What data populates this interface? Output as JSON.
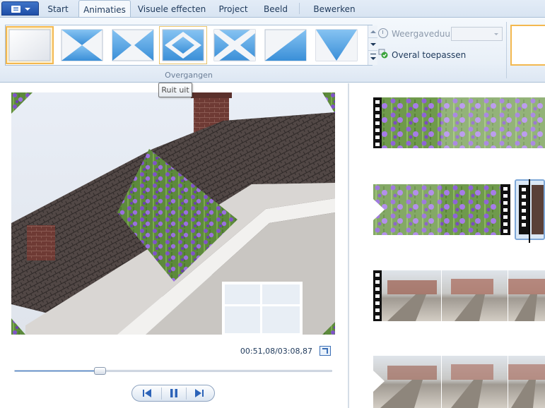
{
  "tabs": [
    {
      "label": "Start",
      "active": false
    },
    {
      "label": "Animaties",
      "active": true
    },
    {
      "label": "Visuele effecten",
      "active": false
    },
    {
      "label": "Project",
      "active": false
    },
    {
      "label": "Beeld",
      "active": false
    },
    {
      "label": "Bewerken",
      "active": false
    }
  ],
  "ribbon": {
    "group_label": "Overgangen",
    "transitions": [
      {
        "icon": "no-transition-icon",
        "selected": true
      },
      {
        "icon": "bowtie-vertical-icon",
        "selected": false
      },
      {
        "icon": "bowtie-horizontal-icon",
        "selected": false
      },
      {
        "icon": "diamond-out-icon",
        "selected": false,
        "hover": true
      },
      {
        "icon": "cross-icon",
        "selected": false
      },
      {
        "icon": "diagonal-wipe-icon",
        "selected": false
      },
      {
        "icon": "v-wipe-icon",
        "selected": false
      }
    ],
    "duration_label": "Weergaveduur:",
    "duration_value": "",
    "apply_all_label": "Overal toepassen"
  },
  "tooltip": {
    "text": "Ruit uit"
  },
  "preview": {
    "timecode": "00:51,08/03:08,87",
    "progress": 0.27
  },
  "colors": {
    "accent": "#4f8cd8",
    "selection": "#f3b84f",
    "ribbon_text": "#1e395b"
  }
}
